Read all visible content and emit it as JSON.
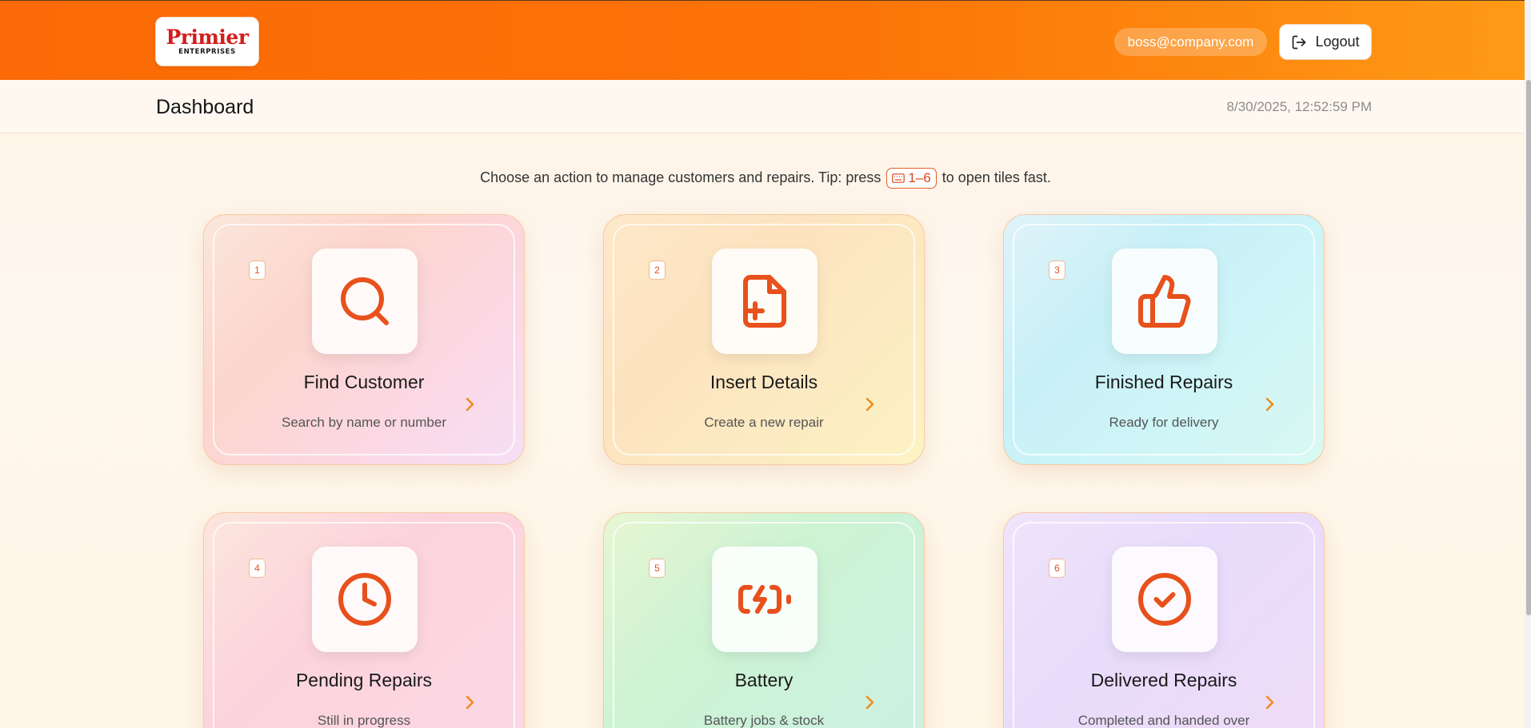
{
  "header": {
    "logo_main": "Primier",
    "logo_sub": "ENTERPRISES",
    "user_email": "boss@company.com",
    "logout_label": "Logout"
  },
  "subheader": {
    "title": "Dashboard",
    "datetime": "8/30/2025, 12:52:59 PM"
  },
  "tip": {
    "text_before": "Choose an action to manage customers and repairs. Tip: press",
    "keys": "1–6",
    "text_after": "to open tiles fast."
  },
  "tiles": [
    {
      "number": "1",
      "title": "Find Customer",
      "subtitle": "Search by name or number",
      "icon": "search-icon"
    },
    {
      "number": "2",
      "title": "Insert Details",
      "subtitle": "Create a new repair",
      "icon": "file-plus-icon"
    },
    {
      "number": "3",
      "title": "Finished Repairs",
      "subtitle": "Ready for delivery",
      "icon": "thumbs-up-icon"
    },
    {
      "number": "4",
      "title": "Pending Repairs",
      "subtitle": "Still in progress",
      "icon": "clock-icon"
    },
    {
      "number": "5",
      "title": "Battery",
      "subtitle": "Battery jobs & stock",
      "icon": "battery-charging-icon"
    },
    {
      "number": "6",
      "title": "Delivered Repairs",
      "subtitle": "Completed and handed over",
      "icon": "check-circle-icon"
    }
  ],
  "colors": {
    "accent": "#e8501c",
    "header_start": "#fb6a06",
    "header_end": "#fe9a16",
    "chevron": "#f08a16"
  }
}
